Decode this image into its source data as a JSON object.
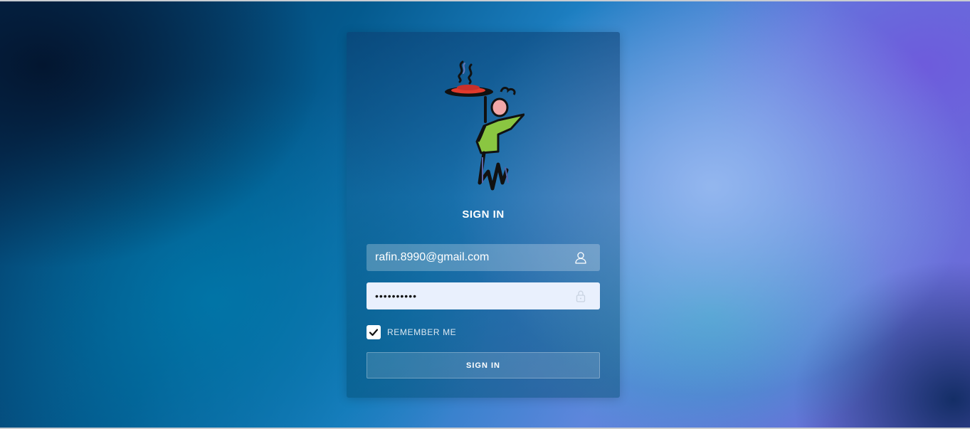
{
  "login": {
    "title": "SIGN IN",
    "email": {
      "value": "rafin.8990@gmail.com",
      "icon": "user-icon"
    },
    "password": {
      "value": "••••••••••",
      "icon": "lock-icon"
    },
    "remember_me": {
      "label": "REMEMBER ME",
      "checked": true
    },
    "submit_label": "SIGN IN"
  },
  "logo": {
    "icon": "waiter-carrying-dish-logo"
  },
  "colors": {
    "background_dark": "#06305a",
    "background_accent": "#6f63d8",
    "password_field_bg": "#e9f0fd",
    "text": "#ffffff"
  }
}
